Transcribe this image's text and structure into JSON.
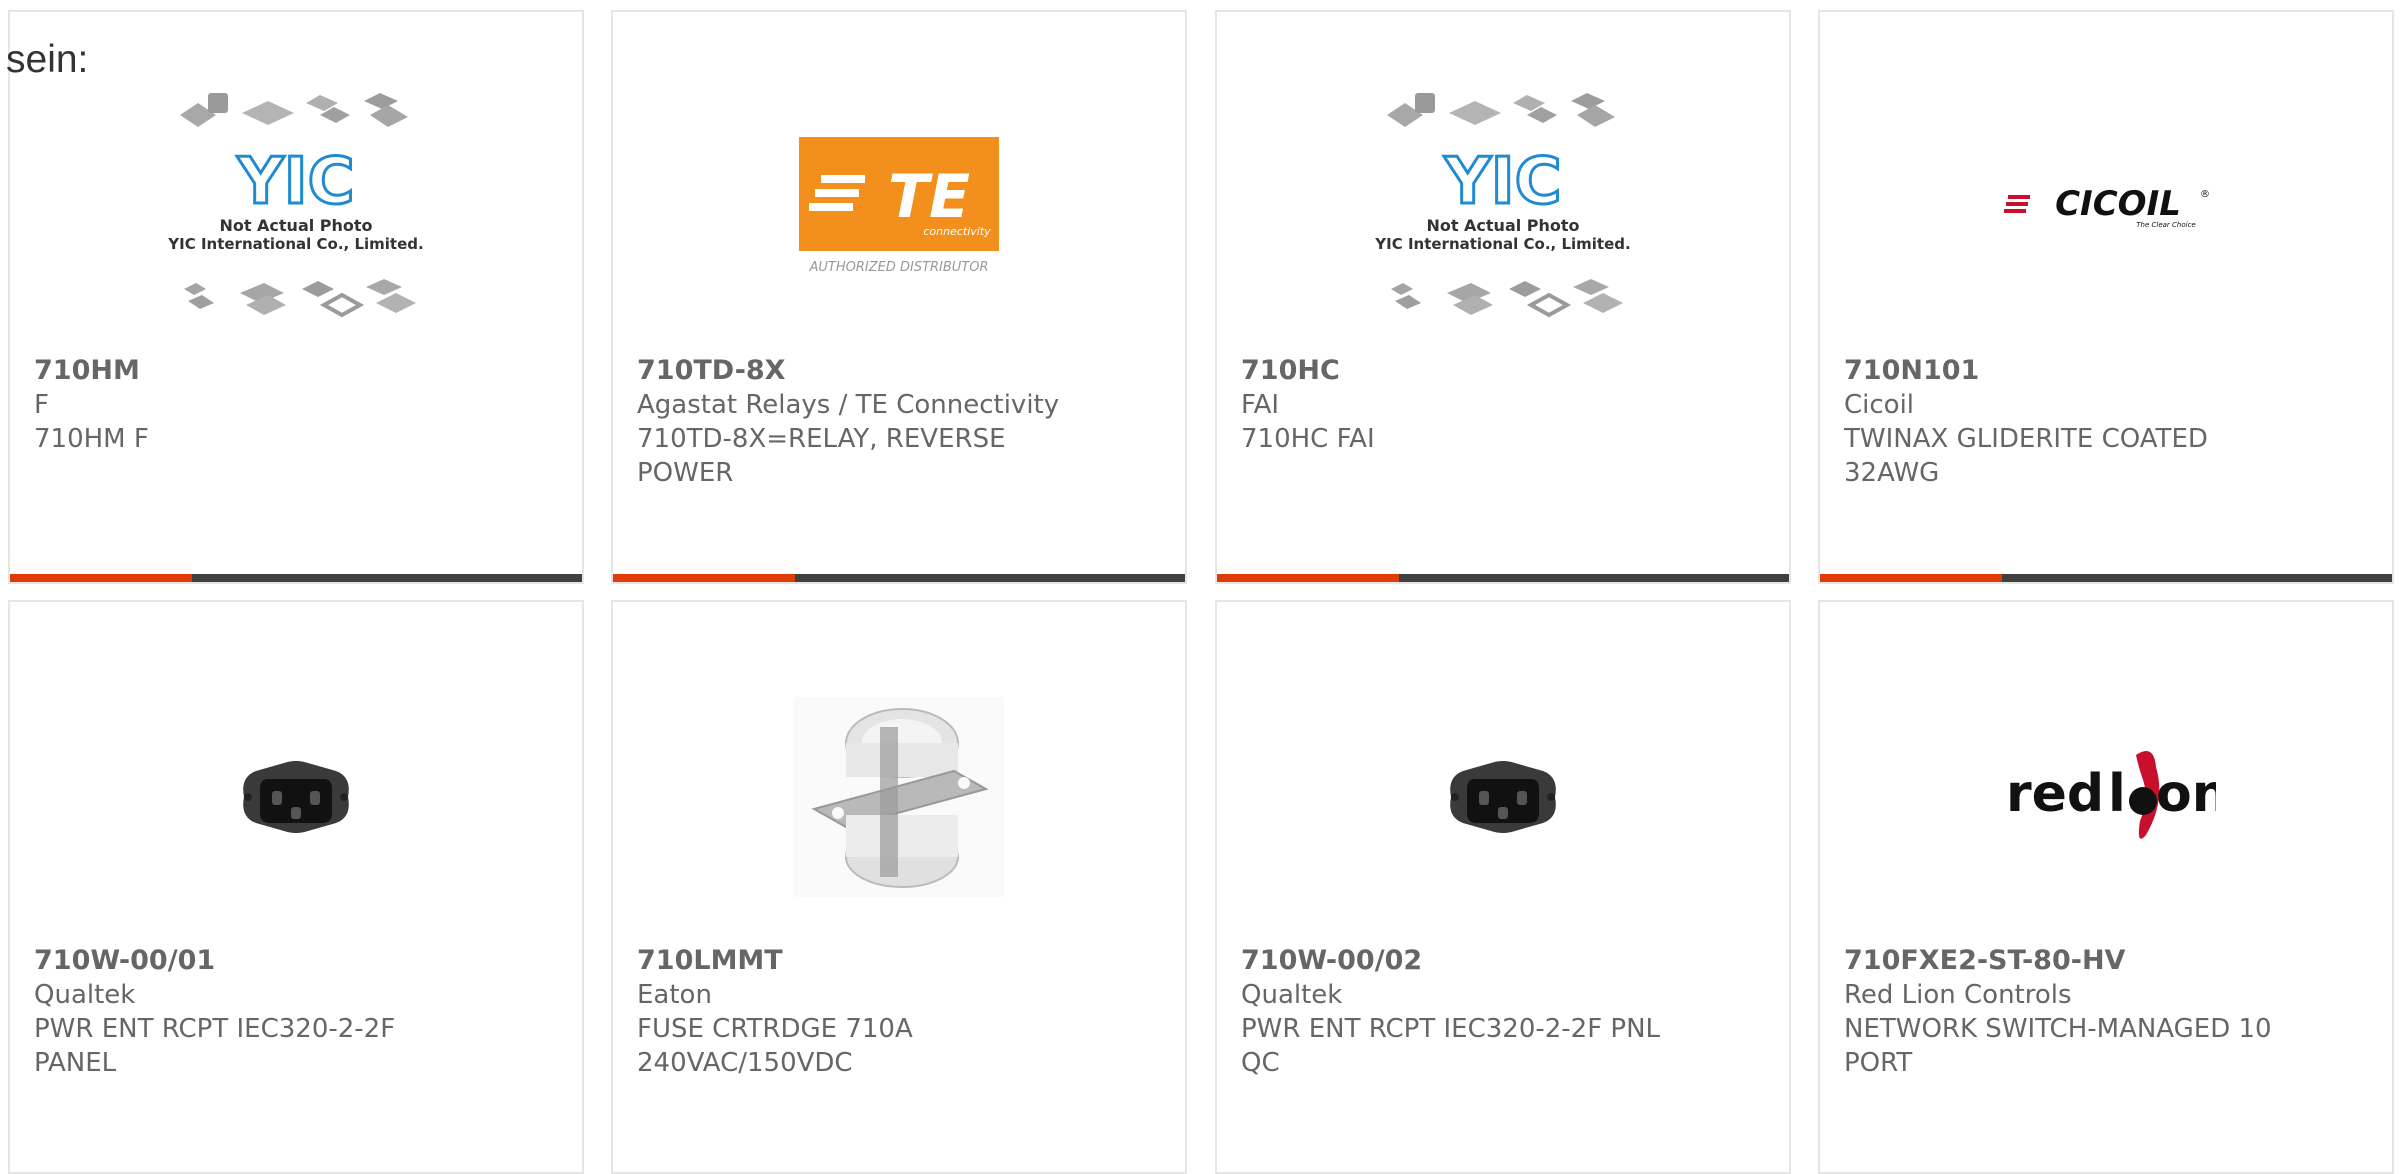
{
  "intro_text": "sein:",
  "colors": {
    "accent": "#e03c0a",
    "bar": "#404040",
    "text": "#666666",
    "border": "#e6e6e6"
  },
  "logos": {
    "yic": {
      "mark": "YIC",
      "caption1": "Not Actual Photo",
      "caption2": "YIC International Co., Limited."
    },
    "te": {
      "mark": "TE",
      "sub": "connectivity",
      "caption": "AUTHORIZED DISTRIBUTOR"
    },
    "cicoil": {
      "mark": "CICOIL",
      "reg": "®",
      "tagline": "The Clear Choice"
    },
    "redlion": {
      "word1": "red",
      "word2": "l",
      "word3": "on"
    }
  },
  "products": [
    {
      "part_number": "710HM",
      "manufacturer": "F",
      "description": "710HM F",
      "image": "yic-placeholder-image"
    },
    {
      "part_number": "710TD-8X",
      "manufacturer": "Agastat Relays / TE Connectivity",
      "description": "710TD-8X=RELAY, REVERSE POWER",
      "image": "te-connectivity-logo"
    },
    {
      "part_number": "710HC",
      "manufacturer": "FAI",
      "description": "710HC FAI",
      "image": "yic-placeholder-image"
    },
    {
      "part_number": "710N101",
      "manufacturer": "Cicoil",
      "description": "TWINAX GLIDERITE COATED 32AWG",
      "image": "cicoil-logo"
    },
    {
      "part_number": "710W-00/01",
      "manufacturer": "Qualtek",
      "description": "PWR ENT RCPT IEC320-2-2F PANEL",
      "image": "power-receptacle-photo"
    },
    {
      "part_number": "710LMMT",
      "manufacturer": "Eaton",
      "description": "FUSE CRTRDGE 710A 240VAC/150VDC",
      "image": "fuse-cartridge-photo"
    },
    {
      "part_number": "710W-00/02",
      "manufacturer": "Qualtek",
      "description": "PWR ENT RCPT IEC320-2-2F PNL QC",
      "image": "power-receptacle-photo"
    },
    {
      "part_number": "710FXE2-ST-80-HV",
      "manufacturer": "Red Lion Controls",
      "description": "NETWORK SWITCH-MANAGED 10 PORT",
      "image": "red-lion-logo"
    }
  ]
}
